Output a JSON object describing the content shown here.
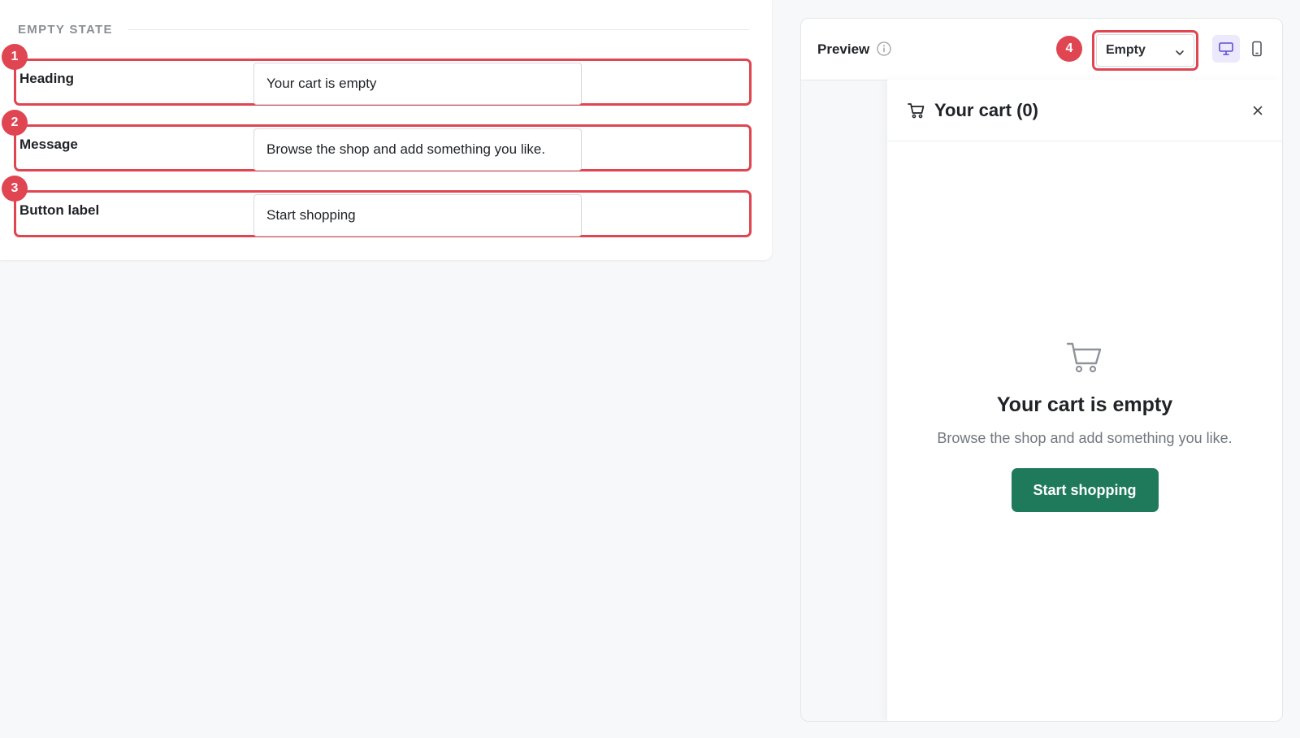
{
  "section": {
    "title": "EMPTY STATE"
  },
  "fields": [
    {
      "badge": "1",
      "label": "Heading",
      "value": "Your cart is empty"
    },
    {
      "badge": "2",
      "label": "Message",
      "value": "Browse the shop and add something you like."
    },
    {
      "badge": "3",
      "label": "Button label",
      "value": "Start shopping"
    }
  ],
  "preview": {
    "title": "Preview",
    "badge": "4",
    "state_select": {
      "selected": "Empty"
    },
    "devices": [
      "desktop-icon",
      "mobile-icon"
    ],
    "drawer": {
      "title": "Your cart (0)",
      "empty_heading": "Your cart is empty",
      "empty_message": "Browse the shop and add something you like.",
      "cta_label": "Start shopping"
    }
  },
  "colors": {
    "annotation_red": "#e04552",
    "cta_green": "#1e7a5b",
    "device_active_bg": "#ebe9fb",
    "device_active_icon": "#5b50d6"
  }
}
